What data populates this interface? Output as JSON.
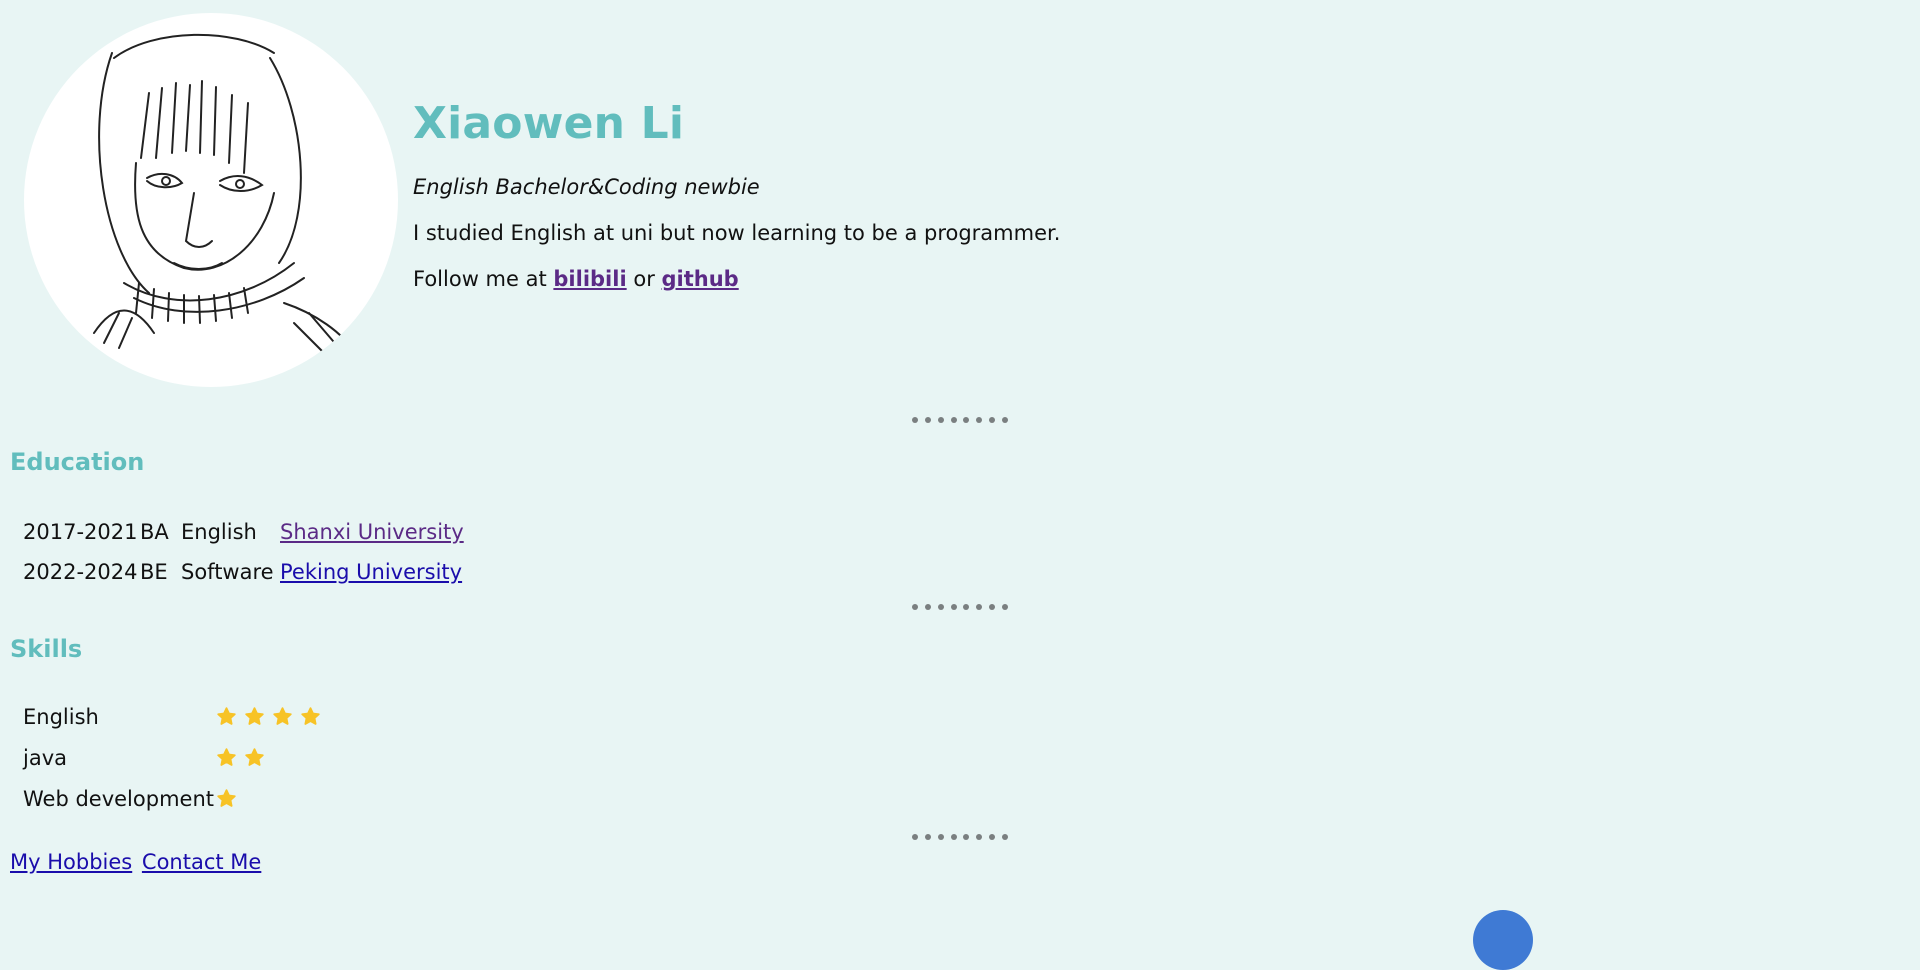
{
  "profile": {
    "name": "Xiaowen Li",
    "tagline": "English Bachelor&Coding newbie",
    "bio": "I studied English at uni but now learning to be a programmer.",
    "follow_prefix": "Follow me at",
    "follow_join": "or",
    "links": [
      {
        "label": "bilibili"
      },
      {
        "label": "github"
      }
    ]
  },
  "education": {
    "title": "Education",
    "rows": [
      {
        "years": "2017-2021",
        "degree": "BA",
        "major": "English",
        "school": "Shanxi University",
        "visited": true
      },
      {
        "years": "2022-2024",
        "degree": "BE",
        "major": "Software",
        "school": "Peking University",
        "visited": false
      }
    ]
  },
  "skills": {
    "title": "Skills",
    "items": [
      {
        "name": "English",
        "rating": 4
      },
      {
        "name": "java",
        "rating": 2
      },
      {
        "name": "Web development",
        "rating": 1
      }
    ]
  },
  "nav": {
    "hobbies": "My Hobbies",
    "contact": "Contact Me"
  },
  "colors": {
    "accent": "#61bdbd",
    "background": "#e8f5f4",
    "star": "#f7c326",
    "link": "#1a0dab",
    "visited_link": "#5b2a86"
  }
}
